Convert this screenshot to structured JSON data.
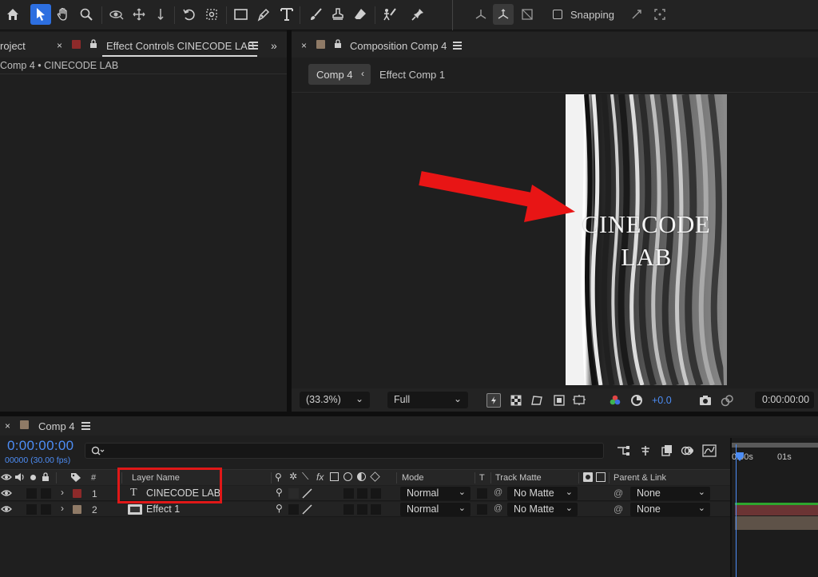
{
  "toolbar": {
    "snapping_label": "Snapping"
  },
  "left_panel": {
    "project_tab": "roject",
    "effect_controls_tab": "Effect Controls CINECODE LAB",
    "breadcrumb": "Comp 4 • CINECODE LAB",
    "more_icon": "double-chevron-right"
  },
  "composition_panel": {
    "tab_title": "Composition Comp 4",
    "active_comp": "Comp 4",
    "nested_comp": "Effect Comp 1",
    "canvas_text_line1": "CINECODE",
    "canvas_text_line2": "LAB",
    "zoom": "(33.3%)",
    "resolution": "Full",
    "exposure": "+0.0",
    "current_time": "0:00:00:00",
    "accent_color": "#4d8df5",
    "annotation_color": "#e81515"
  },
  "timeline": {
    "tab_title": "Comp 4",
    "timecode": "0:00:00:00",
    "fps": "00000 (30.00 fps)",
    "search_placeholder": "",
    "columns": {
      "number": "#",
      "layer_name": "Layer Name",
      "fx": "fx",
      "mode": "Mode",
      "t": "T",
      "track_matte": "Track Matte",
      "parent_link": "Parent & Link"
    },
    "ruler": [
      "0:00s",
      "01s"
    ],
    "layers": [
      {
        "number": "1",
        "type_icon": "T",
        "name": "CINECODE LAB",
        "label_color": "#8e2a2a",
        "mode": "Normal",
        "track_matte": "No Matte",
        "parent": "None"
      },
      {
        "number": "2",
        "type_icon": "comp-icon",
        "name": "Effect 1",
        "label_color": "#8f7a66",
        "mode": "Normal",
        "track_matte": "No Matte",
        "parent": "None"
      }
    ]
  }
}
